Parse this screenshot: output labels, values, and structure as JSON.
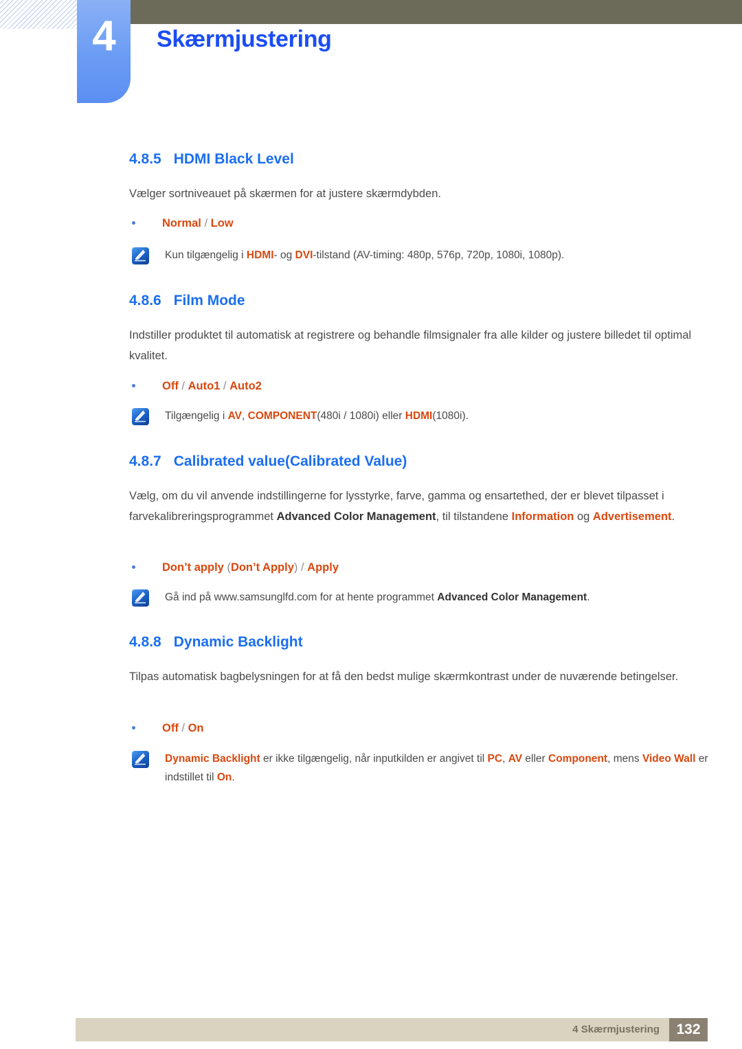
{
  "header": {
    "chapter_number": "4",
    "chapter_title": "Skærmjustering"
  },
  "sections": [
    {
      "number": "4.8.5",
      "title": "HDMI Black Level",
      "paragraph": "Vælger sortniveauet på skærmen for at justere skærmdybden.",
      "bullet": {
        "a": "Normal",
        "sep": " / ",
        "b": "Low"
      },
      "note": {
        "pre": "Kun tilgængelig i ",
        "hl1": "HDMI",
        "mid1": "- og ",
        "hl2": "DVI",
        "post": "-tilstand (AV-timing: 480p, 576p, 720p, 1080i, 1080p)."
      }
    },
    {
      "number": "4.8.6",
      "title": "Film Mode",
      "paragraph": "Indstiller produktet til automatisk at registrere og behandle filmsignaler fra alle kilder og justere billedet til optimal kvalitet.",
      "bullet": {
        "a": "Off",
        "sep1": " / ",
        "b": "Auto1",
        "sep2": " / ",
        "c": "Auto2"
      },
      "note": {
        "pre": "Tilgængelig i ",
        "hl1": "AV",
        "mid1": ", ",
        "hl2": "COMPONENT",
        "mid2": "(480i / 1080i) eller ",
        "hl3": "HDMI",
        "post": "(1080i)."
      }
    },
    {
      "number": "4.8.7",
      "title": "Calibrated value(Calibrated Value)",
      "paragraph_parts": {
        "p1": "Vælg, om du vil anvende indstillingerne for lysstyrke, farve, gamma og ensartethed, der er blevet tilpasset i farvekalibreringsprogrammet ",
        "bold1": "Advanced Color Management",
        "p2": ", til tilstandene ",
        "hl1": "Information",
        "p3": " og ",
        "hl2": "Advertisement",
        "p4": "."
      },
      "bullet": {
        "a": "Don’t apply",
        "open": " (",
        "b": "Don’t Apply",
        "close": ")",
        "sep": " / ",
        "c": "Apply"
      },
      "note": {
        "pre": "Gå ind på www.samsunglfd.com for at hente programmet ",
        "bold1": "Advanced Color Management",
        "post": "."
      }
    },
    {
      "number": "4.8.8",
      "title": "Dynamic Backlight",
      "paragraph": "Tilpas automatisk bagbelysningen for at få den bedst mulige skærmkontrast under de nuværende betingelser.",
      "bullet": {
        "a": "Off",
        "sep": " / ",
        "b": "On"
      },
      "note": {
        "hl1": "Dynamic Backlight",
        "mid1": " er ikke tilgængelig, når inputkilden er angivet til ",
        "hl2": "PC",
        "mid2": ", ",
        "hl3": "AV",
        "mid3": " eller ",
        "hl4": "Component",
        "mid4": ", mens ",
        "hl5": "Video Wall",
        "mid5": " er indstillet til ",
        "hl6": "On",
        "post": "."
      }
    }
  ],
  "footer": {
    "label": "4 Skærmjustering",
    "page": "132"
  },
  "icons": {
    "note": "note-pen-icon"
  },
  "colors": {
    "heading_blue": "#1b6ef0",
    "title_blue": "#1b4df5",
    "highlight_orange": "#d9480f",
    "header_brown": "#6c6a58",
    "tab_blue": "#6a9cf4",
    "footer_beige": "#d9d3c0",
    "footer_page_brown": "#8b8173"
  }
}
